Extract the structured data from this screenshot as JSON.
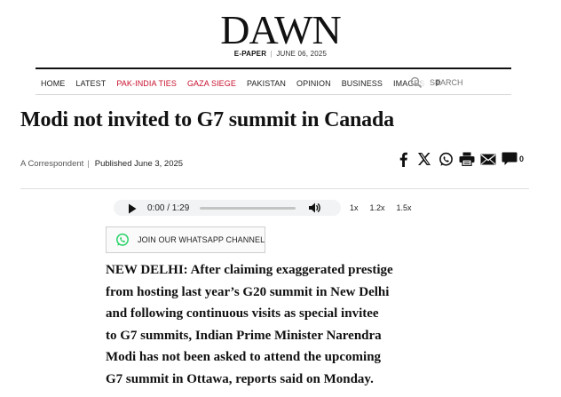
{
  "masthead": {
    "logo": "DAWN",
    "epaper_label": "E-PAPER",
    "separator": "|",
    "date": "JUNE 06, 2025"
  },
  "nav": {
    "items": [
      {
        "label": "HOME",
        "highlight": false
      },
      {
        "label": "LATEST",
        "highlight": false
      },
      {
        "label": "PAK-INDIA TIES",
        "highlight": true
      },
      {
        "label": "GAZA SIEGE",
        "highlight": true
      },
      {
        "label": "PAKISTAN",
        "highlight": false
      },
      {
        "label": "OPINION",
        "highlight": false
      },
      {
        "label": "BUSINESS",
        "highlight": false
      },
      {
        "label": "IMAGES",
        "highlight": false
      },
      {
        "label": "P",
        "highlight": false
      }
    ],
    "search_placeholder": "SEARCH",
    "highlight_color": "#c8102e"
  },
  "article": {
    "headline": "Modi not invited to G7 summit in Canada",
    "author": "A Correspondent",
    "byline_separator": "|",
    "published": "Published June 3, 2025",
    "share_icons": [
      "facebook-icon",
      "x-icon",
      "whatsapp-icon",
      "print-icon",
      "email-icon",
      "comment-icon"
    ],
    "comment_count": "0",
    "body_lines": [
      "NEW DELHI: After claiming exaggerated prestige",
      "from hosting last year’s G20 summit in New Delhi",
      "and following continuous visits as special invitee",
      "to G7 summits, Indian Prime Minister Narendra",
      "Modi has not been asked to attend the upcoming",
      "G7 summit in Ottawa, reports said on Monday."
    ]
  },
  "audio": {
    "time": "0:00 / 1:29",
    "progress": 0,
    "speeds": [
      "1x",
      "1.2x",
      "1.5x"
    ]
  },
  "whatsapp": {
    "label": "JOIN OUR WHATSAPP CHANNEL",
    "color": "#25d366"
  }
}
